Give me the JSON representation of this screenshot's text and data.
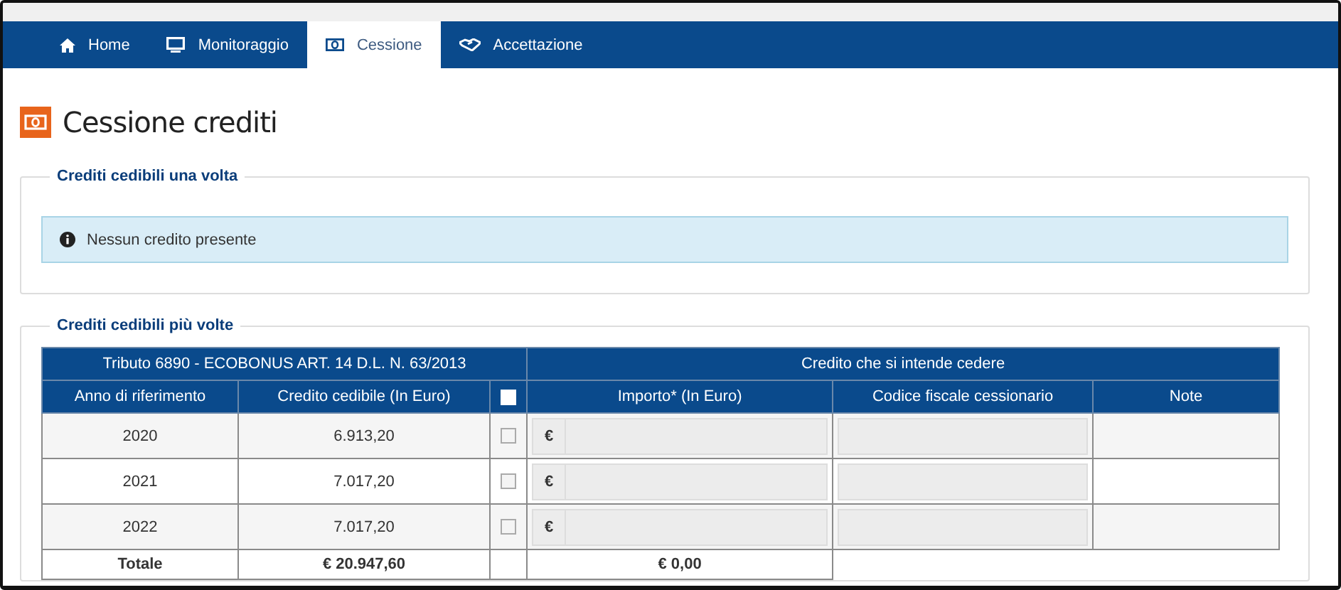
{
  "nav": {
    "tabs": [
      {
        "label": "Home",
        "selected": false
      },
      {
        "label": "Monitoraggio",
        "selected": false
      },
      {
        "label": "Cessione",
        "selected": true
      },
      {
        "label": "Accettazione",
        "selected": false
      }
    ]
  },
  "page_title": "Cessione crediti",
  "sections": [
    {
      "kind": "alert",
      "legend": "Crediti cedibili una volta",
      "message": "Nessun credito presente"
    },
    {
      "kind": "table",
      "legend": "Crediti cedibili più volte",
      "table": {
        "group_headers": [
          "Tributo 6890 - ECOBONUS ART. 14 D.L. N. 63/2013",
          "Credito che si intende cedere"
        ],
        "columns": [
          {
            "kind": "text",
            "label": "Anno di riferimento"
          },
          {
            "kind": "text",
            "label": "Credito cedibile (In Euro)"
          },
          {
            "kind": "checkbox",
            "checked": false
          },
          {
            "kind": "text",
            "label": "Importo* (In Euro)"
          },
          {
            "kind": "text",
            "label": "Codice fiscale cessionario"
          },
          {
            "kind": "text",
            "label": "Note"
          }
        ],
        "rows": [
          {
            "year": "2020",
            "credit": "6.913,20",
            "checked": false,
            "currency": "€",
            "disabled": true
          },
          {
            "year": "2021",
            "credit": "7.017,20",
            "checked": false,
            "currency": "€",
            "disabled": true
          },
          {
            "year": "2022",
            "credit": "7.017,20",
            "checked": false,
            "currency": "€",
            "disabled": true
          }
        ],
        "totals": {
          "label": "Totale",
          "credit": "€ 20.947,60",
          "amount": "€ 0,00"
        }
      }
    }
  ]
}
